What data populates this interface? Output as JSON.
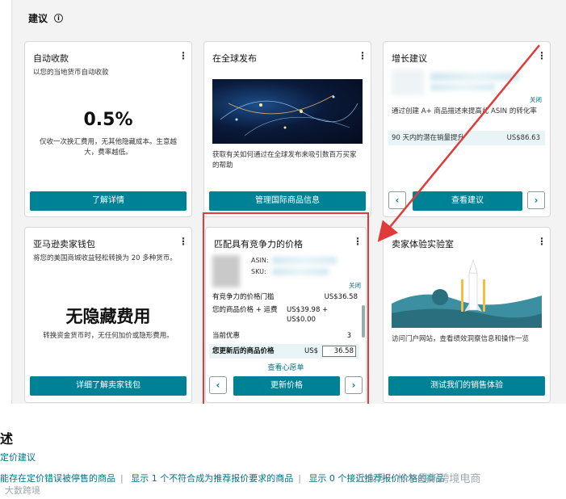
{
  "panel": {
    "title": "建议"
  },
  "cards": {
    "auto_collect": {
      "title": "自动收款",
      "subtitle": "以您的当地货币自动收款",
      "big_value": "0.5%",
      "desc": "仅收一次换汇费用，无其他隐藏成本。生意越大，费率越低。",
      "button": "了解详情"
    },
    "global": {
      "title": "在全球发布",
      "desc": "获取有关如何通过在全球发布来吸引数百万买家的帮助",
      "button": "管理国际商品信息"
    },
    "growth": {
      "title": "增长建议",
      "close": "关闭",
      "desc": "通过创建 A+ 商品描述来提高此 ASIN 的转化率",
      "potential_label": "90 天内的潜在销量提升",
      "potential_value": "US$86.63",
      "prev": "‹",
      "button": "查看建议",
      "next": "›"
    },
    "wallet": {
      "title": "亚马逊卖家钱包",
      "desc": "将您的美国商城收益轻松转换为 20 多种货币。",
      "big_value": "无隐藏费用",
      "sub": "转换资金货币时，无任何加价或隐形费用。",
      "button": "详细了解卖家钱包"
    },
    "price": {
      "title": "匹配具有竞争力的价格",
      "asin_label": "ASIN:",
      "sku_label": "SKU:",
      "close": "关闭",
      "rows": [
        {
          "label": "有竞争力的价格门槛",
          "value": "US$36.58"
        },
        {
          "label": "您的商品价格 + 运费",
          "value": "US$39.98 + US$0.00"
        },
        {
          "label": "当前优惠",
          "value": "3"
        }
      ],
      "update_label": "您更新后的商品价格",
      "currency": "US$",
      "input_value": "36.58",
      "heart_link": "查看心愿单",
      "prev": "‹",
      "button": "更新价格",
      "next": "›"
    },
    "lab": {
      "title": "卖家体验实验室",
      "desc": "访问门户网站，查看绩效洞察信息和操作一览",
      "button": "测试我们的销售体验"
    }
  },
  "bottom": {
    "title": "述",
    "subtitle": "定价建议",
    "links": [
      "能存在定价错误被停售的商品",
      "显示 1 个不符合成为推荐报价要求的商品",
      "显示 0 个接近推荐报价价格的商品"
    ],
    "watermark": "公众号 · 林尔墨斯跨境电商",
    "watermark2": "大数跨境"
  },
  "colors": {
    "accent": "#008296",
    "highlight": "#e03a3a"
  }
}
